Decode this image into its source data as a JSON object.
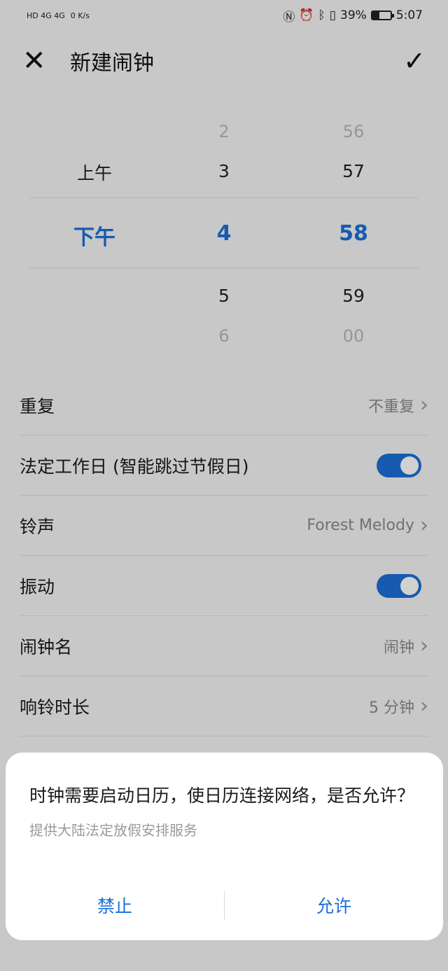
{
  "status_bar": {
    "left": "HD 4G 4G",
    "speed": "0 K/s",
    "battery": "39%",
    "time": "5:07",
    "battery_level": 0.39
  },
  "title_bar": {
    "title": "新建闹钟"
  },
  "picker": {
    "period": {
      "above": "上午",
      "selected": "下午"
    },
    "hour": {
      "far_above": "2",
      "above": "3",
      "selected": "4",
      "below": "5",
      "far_below": "6"
    },
    "minute": {
      "far_above": "56",
      "above": "57",
      "selected": "58",
      "below": "59",
      "far_below": "00"
    }
  },
  "settings": {
    "repeat_label": "重复",
    "repeat_value": "不重复",
    "workday_label": "法定工作日 (智能跳过节假日)",
    "workday_on": true,
    "ringtone_label": "铃声",
    "ringtone_value": "Forest Melody",
    "vibrate_label": "振动",
    "vibrate_on": true,
    "name_label": "闹钟名",
    "name_value": "闹钟",
    "duration_label": "响铃时长",
    "duration_value": "5 分钟"
  },
  "dialog": {
    "message": "时钟需要启动日历，使日历连接网络，是否允许？",
    "sub": "提供大陆法定放假安排服务",
    "deny": "禁止",
    "allow": "允许"
  },
  "colors": {
    "accent": "#1b6fd6"
  }
}
